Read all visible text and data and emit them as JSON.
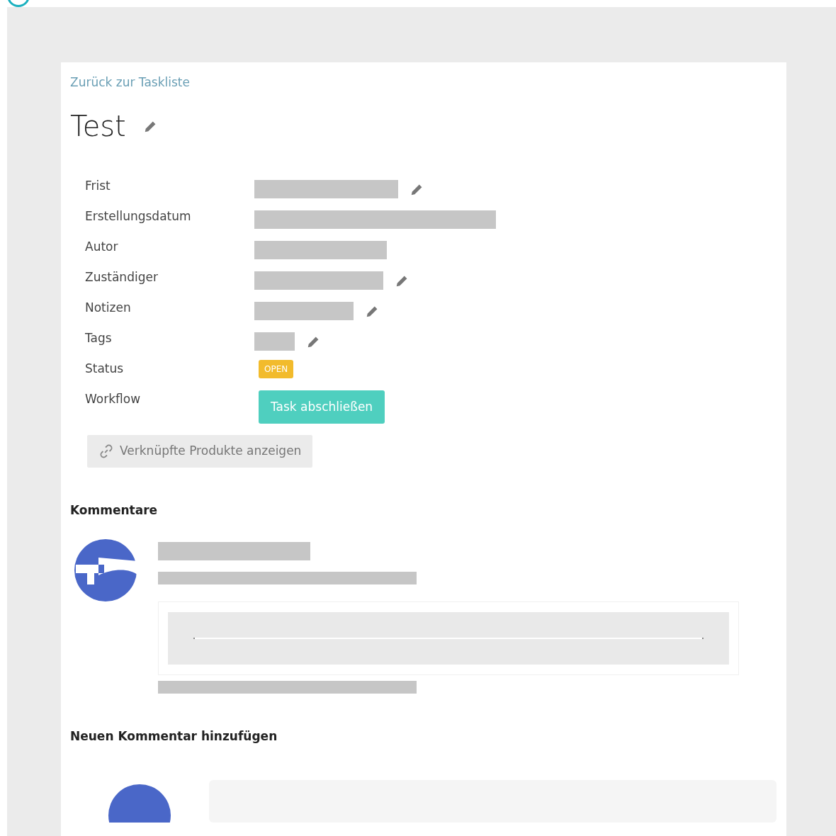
{
  "back_link": "Zurück zur Taskliste",
  "title": {
    "text": "Test",
    "editable": true
  },
  "fields": [
    {
      "kind": "redacted",
      "label": "Frist",
      "editable": true
    },
    {
      "kind": "redacted",
      "label": "Erstellungsdatum",
      "editable": false
    },
    {
      "kind": "redacted",
      "label": "Autor",
      "editable": false
    },
    {
      "kind": "redacted",
      "label": "Zuständiger",
      "editable": true
    },
    {
      "kind": "redacted",
      "label": "Notizen",
      "editable": true
    },
    {
      "kind": "redacted",
      "label": "Tags",
      "editable": true
    },
    {
      "kind": "badge",
      "label": "Status",
      "value": "OPEN"
    },
    {
      "kind": "button",
      "label": "Workflow",
      "value": "Task abschließen"
    }
  ],
  "linked_products_button": "Verknüpfte Produkte anzeigen",
  "comments": {
    "heading": "Kommentare"
  },
  "new_comment": {
    "heading": "Neuen Kommentar hinzufügen"
  }
}
